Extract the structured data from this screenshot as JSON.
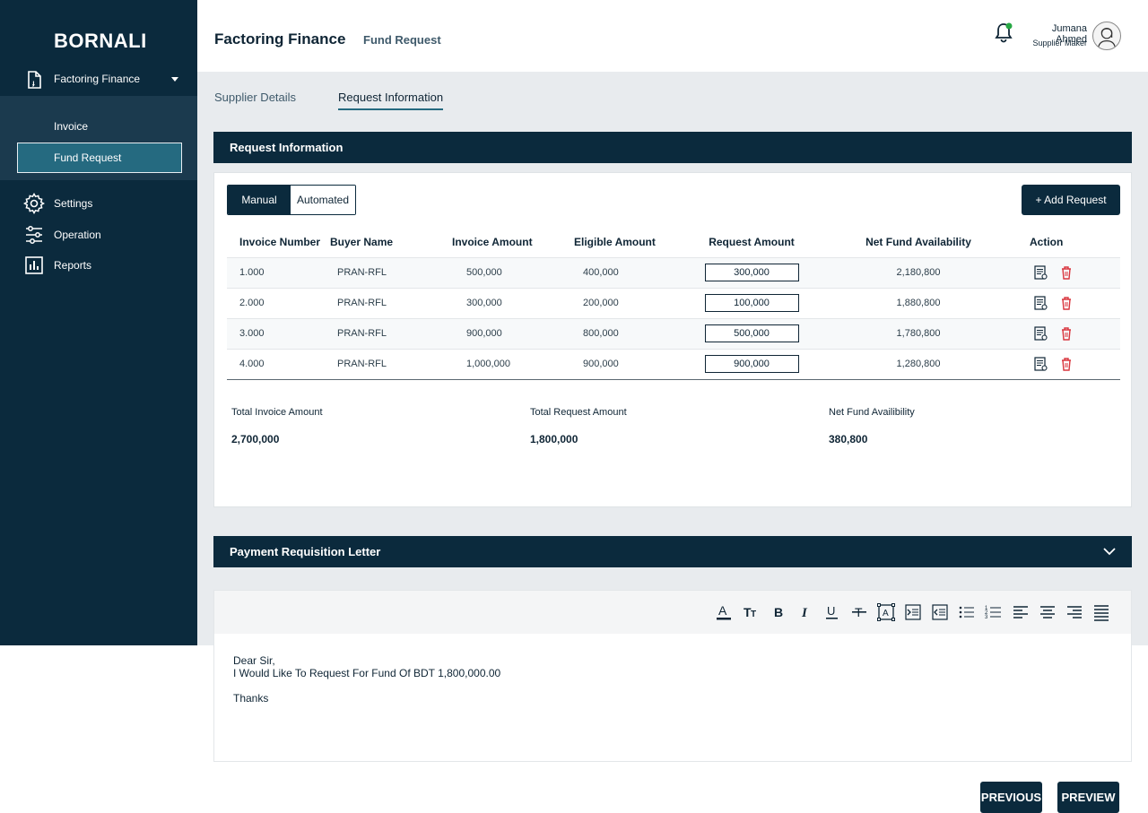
{
  "sidebar": {
    "brand": "BORNALI",
    "parent": {
      "label": "Factoring Finance",
      "icon": "document-icon"
    },
    "submenu": [
      {
        "label": "Invoice"
      },
      {
        "label": "Fund Request",
        "active": true
      }
    ],
    "items": [
      {
        "label": "Settings",
        "icon": "gear-icon"
      },
      {
        "label": "Operation",
        "icon": "sliders-icon"
      },
      {
        "label": "Reports",
        "icon": "bar-chart-icon"
      }
    ]
  },
  "header": {
    "title": "Factoring Finance",
    "subtitle": "Fund Request",
    "user_name": "Jumana Ahmed",
    "user_role": "Supplier Maker"
  },
  "tabs": [
    {
      "label": "Supplier Details"
    },
    {
      "label": "Request Information",
      "active": true
    }
  ],
  "request_panel": {
    "title": "Request Information",
    "toggle": {
      "manual": "Manual",
      "automated": "Automated",
      "selected": "Manual"
    },
    "add_button": "+ Add Request",
    "columns": [
      "Invoice Number",
      "Buyer Name",
      "Invoice Amount",
      "Eligible Amount",
      "Request Amount",
      "Net Fund Availability",
      "Action"
    ],
    "rows": [
      {
        "invoice": "1.000",
        "buyer": "PRAN-RFL",
        "amount": "500,000",
        "eligible": "400,000",
        "request": "300,000",
        "net": "2,180,800"
      },
      {
        "invoice": "2.000",
        "buyer": "PRAN-RFL",
        "amount": "300,000",
        "eligible": "200,000",
        "request": "100,000",
        "net": "1,880,800"
      },
      {
        "invoice": "3.000",
        "buyer": "PRAN-RFL",
        "amount": "900,000",
        "eligible": "800,000",
        "request": "500,000",
        "net": "1,780,800"
      },
      {
        "invoice": "4.000",
        "buyer": "PRAN-RFL",
        "amount": "1,000,000",
        "eligible": "900,000",
        "request": "900,000",
        "net": "1,280,800"
      }
    ],
    "summary": {
      "total_invoice_label": "Total Invoice Amount",
      "total_invoice_value": "2,700,000",
      "total_request_label": "Total Request Amount",
      "total_request_value": "1,800,000",
      "net_fund_label": "Net Fund Availibility",
      "net_fund_value": "380,800"
    }
  },
  "letter_panel": {
    "title": "Payment Requisition Letter",
    "line1": "Dear Sir,",
    "line2": "I Would Like To Request For Fund Of BDT 1,800,000.00",
    "line3": "Thanks"
  },
  "footer": {
    "previous": "PREVIOUS",
    "preview": "PREVIEW"
  },
  "colors": {
    "navy": "#0b2a3d",
    "teal": "#256a80",
    "delete_red": "#d9363e",
    "notify_green": "#27a844"
  }
}
